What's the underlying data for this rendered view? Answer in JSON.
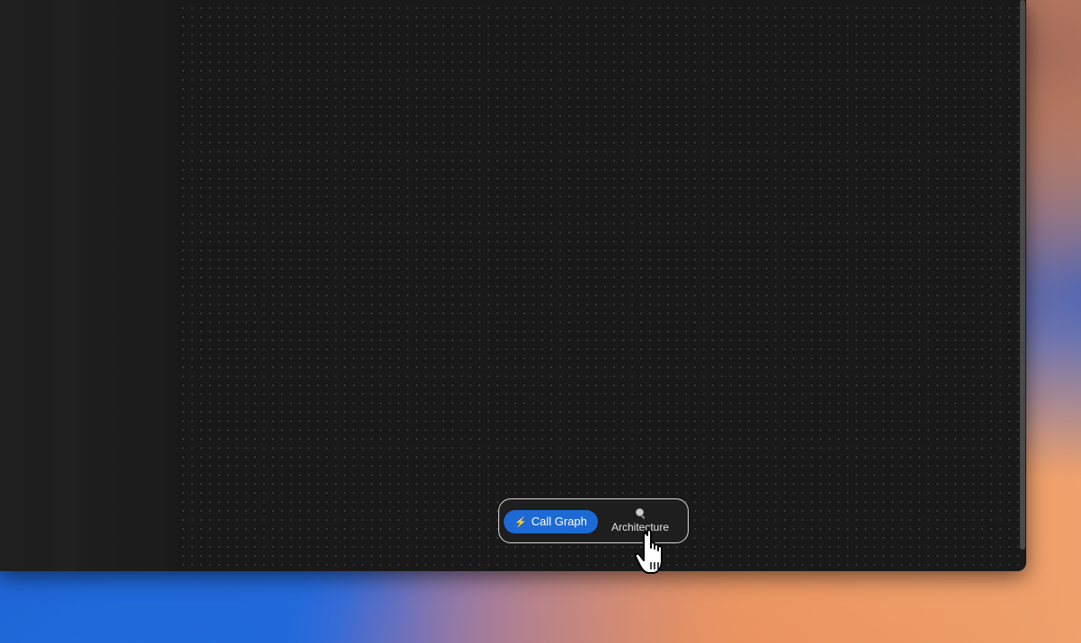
{
  "toggle": {
    "call_graph_label": "Call Graph",
    "call_graph_icon": "lightning-bolt-icon",
    "architecture_label": "Architecture",
    "architecture_icon": "magnifier-icon",
    "active": "call_graph",
    "active_color": "#1d6ad6"
  },
  "cursor": {
    "icon": "pointing-hand-cursor-icon"
  }
}
